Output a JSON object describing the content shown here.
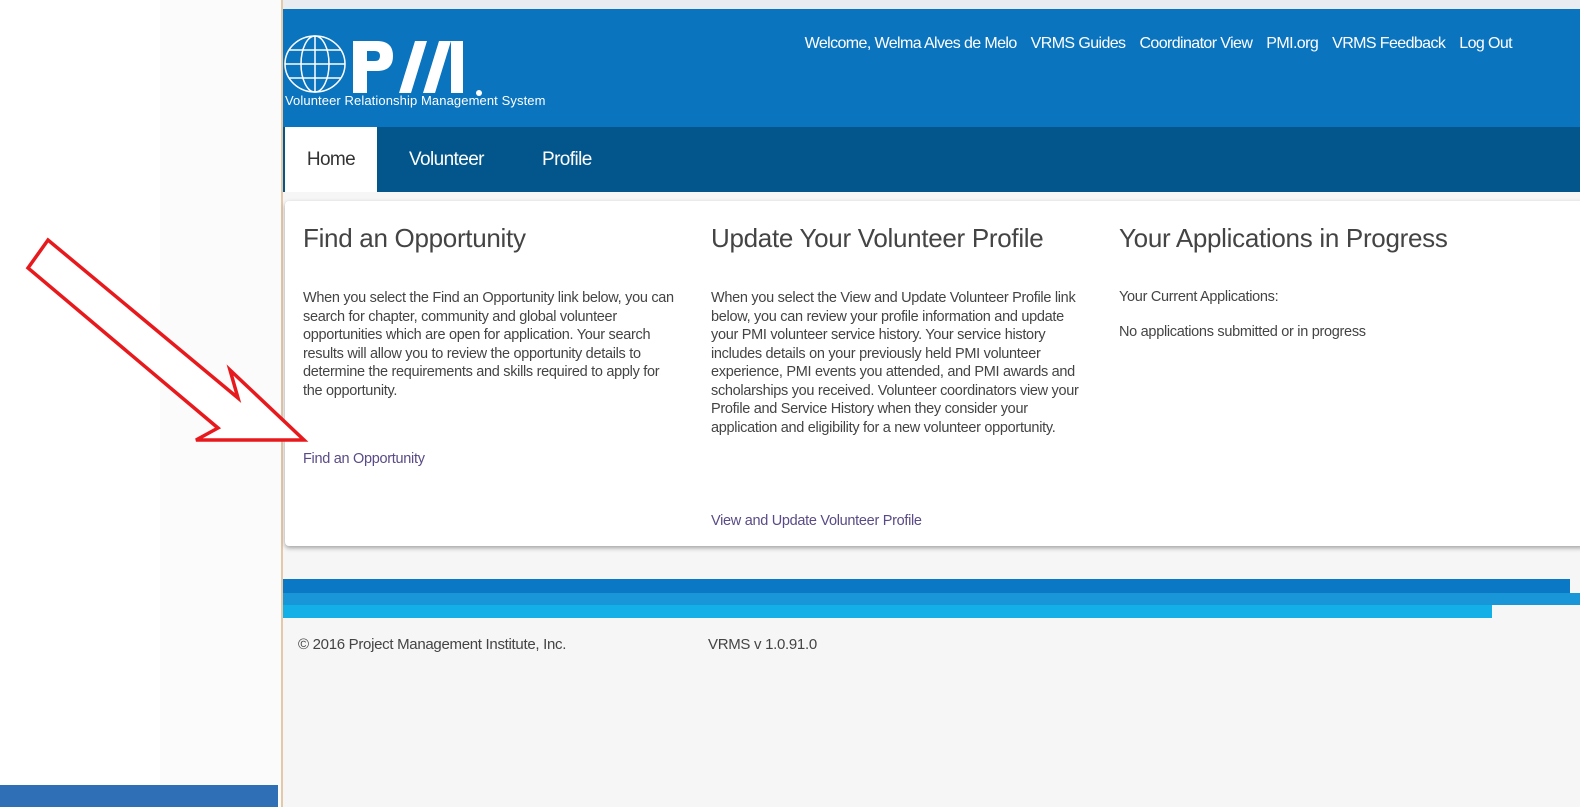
{
  "header": {
    "system_name": "Volunteer Relationship Management System",
    "top_links": [
      "Welcome, Welma Alves de Melo",
      "VRMS Guides",
      "Coordinator View",
      "PMI.org",
      "VRMS Feedback",
      "Log Out"
    ]
  },
  "nav": {
    "tabs": [
      {
        "label": "Home"
      },
      {
        "label": "Volunteer"
      },
      {
        "label": "Profile"
      }
    ]
  },
  "main": {
    "find": {
      "title": "Find an Opportunity",
      "body": "When you select the Find an Opportunity link below, you can search for chapter, community and global volunteer opportunities which are open for application. Your search results will allow you to review the opportunity details to determine the requirements and skills required to apply for the opportunity.",
      "link": "Find an Opportunity"
    },
    "profile": {
      "title": "Update Your Volunteer Profile",
      "body": "When you select the View and Update Volunteer Profile link below, you can review your profile information and update your PMI volunteer service history. Your service history includes details on your previously held PMI volunteer experience, PMI events you attended, and PMI awards and scholarships you received. Volunteer coordinators view your Profile and Service History when they consider your application and eligibility for a new volunteer opportunity.",
      "link": "View and Update Volunteer Profile"
    },
    "applications": {
      "title": "Your Applications in Progress",
      "current_label": "Your Current Applications:",
      "status": "No applications submitted or in progress"
    }
  },
  "footer": {
    "copyright": "© 2016 Project Management Institute, Inc.",
    "version": "VRMS v 1.0.91.0"
  },
  "colors": {
    "header_blue": "#0a74bf",
    "nav_blue": "#03568b",
    "link_purple": "#5a4b86",
    "annotation_arrow": "#e8191c"
  }
}
